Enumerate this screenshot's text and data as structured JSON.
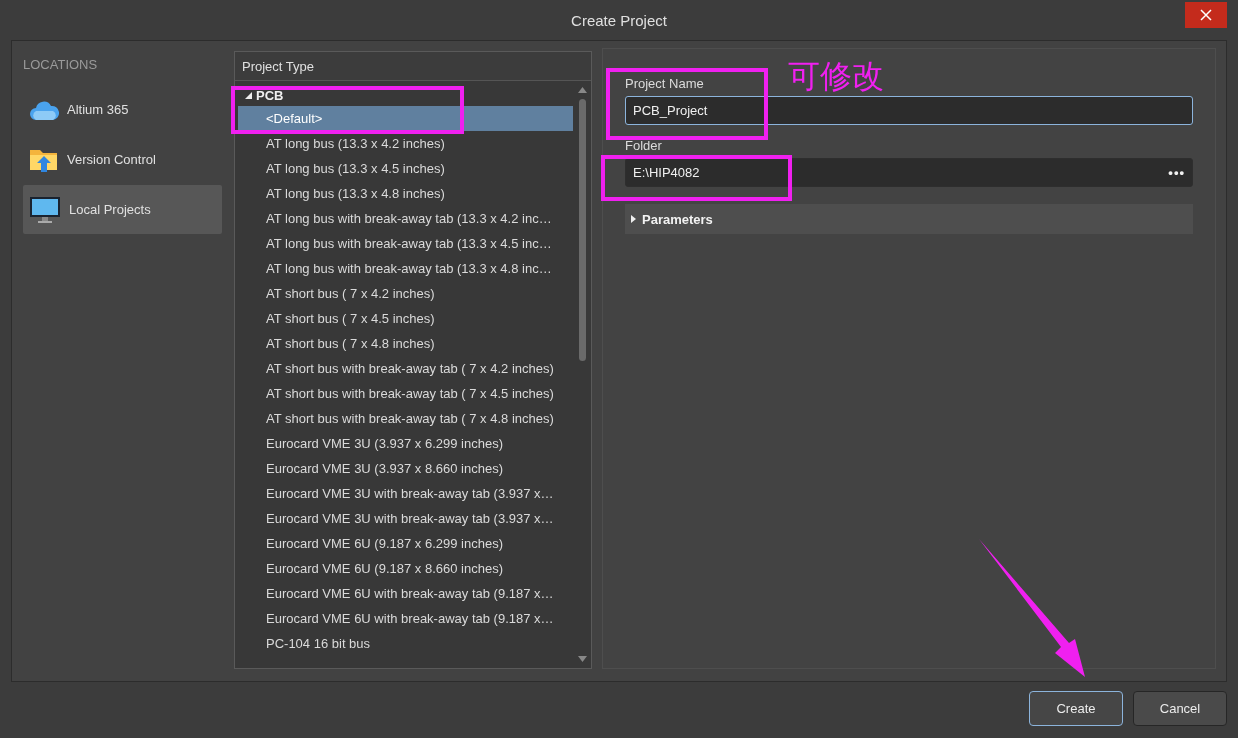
{
  "window": {
    "title": "Create Project"
  },
  "locations": {
    "heading": "LOCATIONS",
    "items": [
      {
        "label": "Altium 365",
        "kind": "cloud",
        "selected": false
      },
      {
        "label": "Version Control",
        "kind": "folder",
        "selected": false
      },
      {
        "label": "Local Projects",
        "kind": "monitor",
        "selected": true
      }
    ]
  },
  "project_type": {
    "header": "Project Type",
    "groups": [
      {
        "label": "PCB",
        "expanded": true,
        "children": [
          {
            "label": "<Default>",
            "selected": true
          },
          {
            "label": "AT long bus (13.3 x 4.2 inches)",
            "selected": false
          },
          {
            "label": "AT long bus (13.3 x 4.5 inches)",
            "selected": false
          },
          {
            "label": "AT long bus (13.3 x 4.8 inches)",
            "selected": false
          },
          {
            "label": "AT long bus with break-away tab (13.3 x 4.2 inc…",
            "selected": false
          },
          {
            "label": "AT long bus with break-away tab (13.3 x 4.5 inc…",
            "selected": false
          },
          {
            "label": "AT long bus with break-away tab (13.3 x 4.8 inc…",
            "selected": false
          },
          {
            "label": "AT short bus ( 7 x 4.2 inches)",
            "selected": false
          },
          {
            "label": "AT short bus ( 7 x 4.5 inches)",
            "selected": false
          },
          {
            "label": "AT short bus ( 7 x 4.8 inches)",
            "selected": false
          },
          {
            "label": "AT short bus with break-away tab ( 7 x 4.2 inches)",
            "selected": false
          },
          {
            "label": "AT short bus with break-away tab ( 7 x 4.5 inches)",
            "selected": false
          },
          {
            "label": "AT short bus with break-away tab ( 7 x 4.8 inches)",
            "selected": false
          },
          {
            "label": "Eurocard VME 3U (3.937 x 6.299 inches)",
            "selected": false
          },
          {
            "label": "Eurocard VME 3U (3.937 x 8.660 inches)",
            "selected": false
          },
          {
            "label": "Eurocard VME 3U with break-away tab (3.937 x…",
            "selected": false
          },
          {
            "label": "Eurocard VME 3U with break-away tab (3.937 x…",
            "selected": false
          },
          {
            "label": "Eurocard VME 6U (9.187 x 6.299 inches)",
            "selected": false
          },
          {
            "label": "Eurocard VME 6U (9.187 x 8.660 inches)",
            "selected": false
          },
          {
            "label": "Eurocard VME 6U with break-away tab (9.187 x…",
            "selected": false
          },
          {
            "label": "Eurocard VME 6U with break-away tab (9.187 x…",
            "selected": false
          },
          {
            "label": "PC-104 16 bit bus",
            "selected": false
          }
        ]
      }
    ]
  },
  "form": {
    "project_name": {
      "label": "Project Name",
      "value": "PCB_Project"
    },
    "folder": {
      "label": "Folder",
      "value": "E:\\HIP4082",
      "browse": "•••"
    },
    "parameters": {
      "label": "Parameters",
      "expanded": false
    }
  },
  "annotation": {
    "note": "可修改"
  },
  "buttons": [
    {
      "label": "Create",
      "default": true
    },
    {
      "label": "Cancel",
      "default": false
    }
  ]
}
